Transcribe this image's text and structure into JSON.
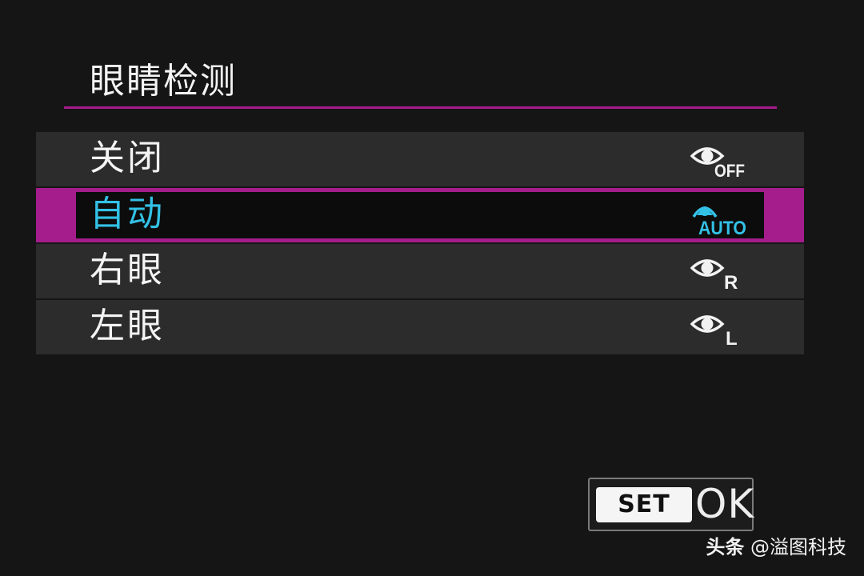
{
  "screen": {
    "title": "眼睛检测"
  },
  "menu": {
    "items": [
      {
        "label": "关闭",
        "icon": "eye-off-icon",
        "badge": "OFF",
        "selected": false
      },
      {
        "label": "自动",
        "icon": "eye-auto-icon",
        "badge": "AUTO",
        "selected": true
      },
      {
        "label": "右眼",
        "icon": "eye-right-icon",
        "badge": "R",
        "selected": false
      },
      {
        "label": "左眼",
        "icon": "eye-left-icon",
        "badge": "L",
        "selected": false
      }
    ]
  },
  "footer": {
    "set_key": "SET",
    "ok_label": "OK"
  },
  "watermark": {
    "brand": "头条",
    "handle": "@溢图科技"
  },
  "colors": {
    "accent": "#a51c8c",
    "selected_text": "#33c1e6",
    "row_background": "#2c2c2c",
    "background": "#151515"
  }
}
